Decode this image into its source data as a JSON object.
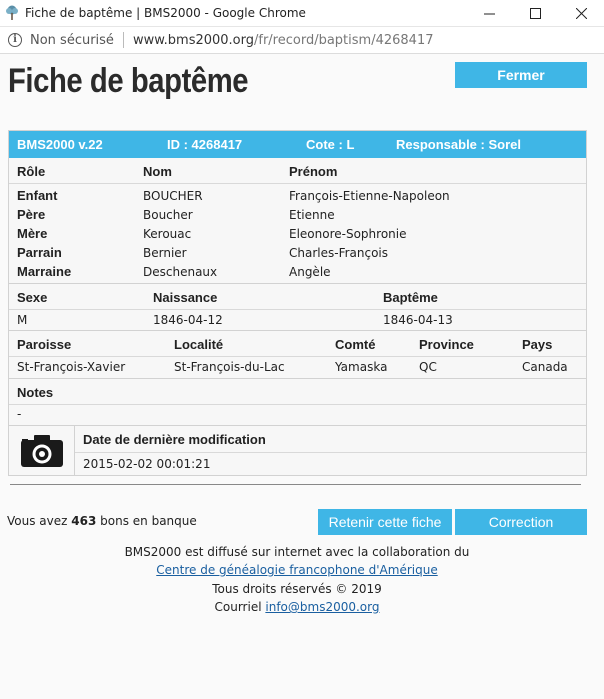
{
  "window": {
    "title": "Fiche de baptême | BMS2000 - Google Chrome",
    "minimize_glyph": "—",
    "maximize_glyph": "☐",
    "close_glyph": "✕"
  },
  "address_bar": {
    "security_label": "Non sécurisé",
    "url_host": "www.bms2000.org",
    "url_path": "/fr/record/baptism/4268417"
  },
  "page": {
    "title": "Fiche de baptême",
    "close_button": "Fermer"
  },
  "record_header": {
    "version": "BMS2000 v.22",
    "id": "ID : 4268417",
    "cote": "Cote : L",
    "responsable": "Responsable : Sorel"
  },
  "persons": {
    "headers": [
      "Rôle",
      "Nom",
      "Prénom"
    ],
    "rows": [
      {
        "role": "Enfant",
        "nom": "BOUCHER",
        "prenom": "François-Etienne-Napoleon"
      },
      {
        "role": "Père",
        "nom": "Boucher",
        "prenom": "Etienne"
      },
      {
        "role": "Mère",
        "nom": "Kerouac",
        "prenom": "Eleonore-Sophronie"
      },
      {
        "role": "Parrain",
        "nom": "Bernier",
        "prenom": "Charles-François"
      },
      {
        "role": "Marraine",
        "nom": "Deschenaux",
        "prenom": "Angèle"
      }
    ]
  },
  "dates": {
    "headers": [
      "Sexe",
      "Naissance",
      "Baptême"
    ],
    "values": [
      "M",
      "1846-04-12",
      "1846-04-13"
    ]
  },
  "location": {
    "headers": [
      "Paroisse",
      "Localité",
      "Comté",
      "Province",
      "Pays"
    ],
    "values": [
      "St-François-Xavier",
      "St-François-du-Lac",
      "Yamaska",
      "QC",
      "Canada"
    ]
  },
  "notes": {
    "header": "Notes",
    "value": "-"
  },
  "modification": {
    "header": "Date de dernière modification",
    "value": "2015-02-02 00:01:21"
  },
  "account": {
    "prefix": "Vous avez",
    "count": "463",
    "suffix": "bons en banque",
    "retain_button": "Retenir cette fiche",
    "correction_button": "Correction"
  },
  "footer": {
    "line1": "BMS2000 est diffusé sur internet avec la collaboration du",
    "link": "Centre de généalogie francophone d'Amérique",
    "rights": "Tous droits réservés © 2019",
    "contact_prefix": "Courriel",
    "email": "info@bms2000.org"
  },
  "colors": {
    "accent": "#3fb6e6",
    "link": "#1a5fa0"
  }
}
